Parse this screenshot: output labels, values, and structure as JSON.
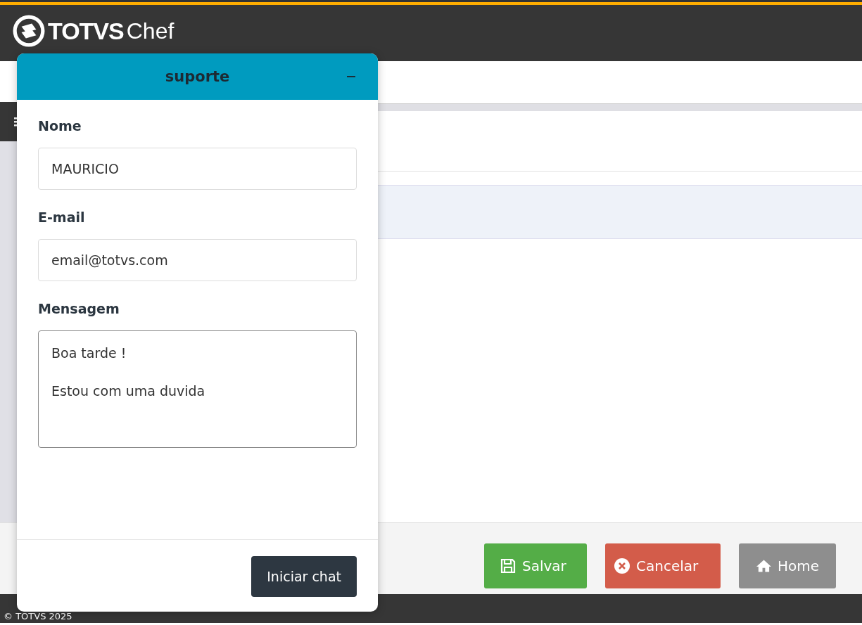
{
  "header": {
    "logo_word": "TOTVS",
    "logo_sub": "Chef"
  },
  "chat": {
    "title": "suporte",
    "fields": [
      {
        "kind": "input",
        "label": "Nome",
        "value": "MAURICIO"
      },
      {
        "kind": "input",
        "label": "E-mail",
        "value": "email@totvs.com"
      },
      {
        "kind": "textarea",
        "label": "Mensagem",
        "value": "Boa tarde !\n\nEstou com uma duvida"
      }
    ],
    "start_button": "Iniciar chat"
  },
  "actions": [
    {
      "kind": "save",
      "label": "Salvar"
    },
    {
      "kind": "cancel",
      "label": "Cancelar"
    },
    {
      "kind": "home",
      "label": "Home"
    }
  ],
  "footer": {
    "copyright": "© TOTVS 2025"
  }
}
